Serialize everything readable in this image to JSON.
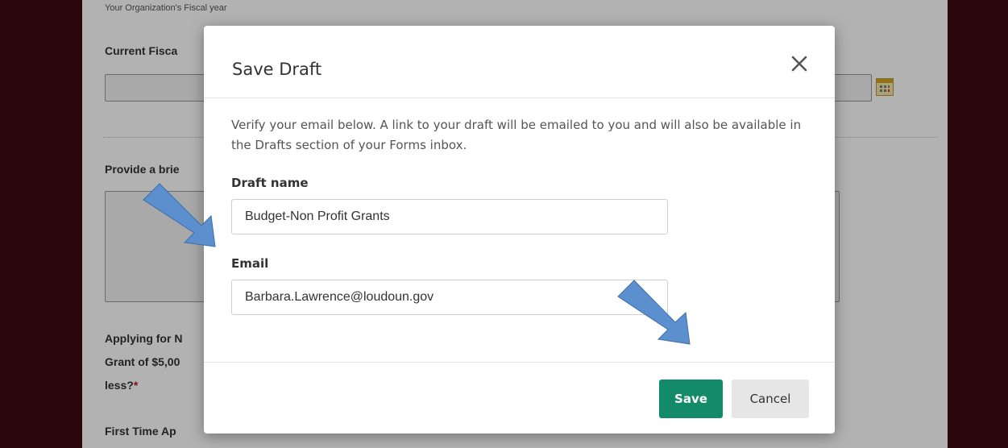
{
  "background_form": {
    "fiscal_year_hint": "Your Organization's Fiscal year",
    "current_fiscal_label": "Current Fisca",
    "provide_brief_label": "Provide a brie",
    "applying_label_line1": "Applying for N",
    "applying_label_line2": "Grant of $5,00",
    "applying_label_line3": "less?",
    "required_mark": "*",
    "first_time_label": "First Time Ap"
  },
  "modal": {
    "title": "Save Draft",
    "close_symbol": "✕",
    "description": "Verify your email below. A link to your draft will be emailed to you and will also be available in the Drafts section of your Forms inbox.",
    "draft_name_label": "Draft name",
    "draft_name_value": "Budget-Non Profit Grants",
    "email_label": "Email",
    "email_value": "Barbara.Lawrence@loudoun.gov",
    "save_label": "Save",
    "cancel_label": "Cancel"
  },
  "colors": {
    "save_button": "#138a68",
    "cancel_button": "#e6e6e6",
    "annotation_arrow": "#5b8fce",
    "page_frame": "#3b0a12"
  },
  "icons": [
    "calendar-icon",
    "close-icon",
    "annotation-arrow"
  ]
}
